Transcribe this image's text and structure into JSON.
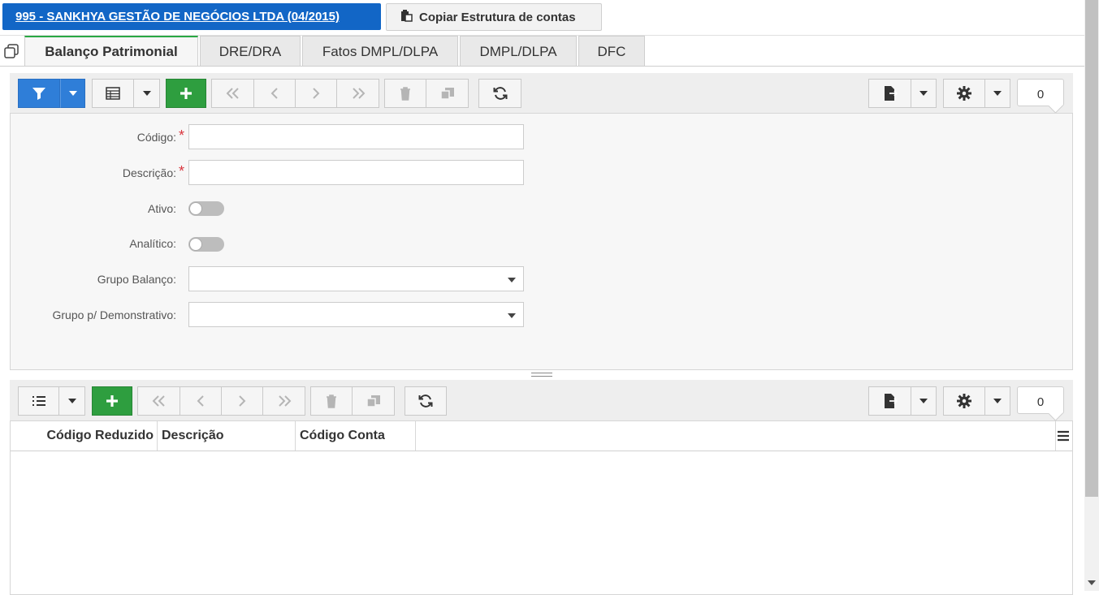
{
  "header": {
    "company_label": "995 - SANKHYA GESTÃO DE NEGÓCIOS LTDA (04/2015)",
    "copy_structure_label": "Copiar Estrutura de contas"
  },
  "tabs": [
    {
      "label": "Balanço Patrimonial",
      "active": true
    },
    {
      "label": "DRE/DRA",
      "active": false
    },
    {
      "label": "Fatos DMPL/DLPA",
      "active": false
    },
    {
      "label": "DMPL/DLPA",
      "active": false
    },
    {
      "label": "DFC",
      "active": false
    }
  ],
  "top_toolbar": {
    "record_count": "0",
    "icons": [
      "filter-icon",
      "caret-down-icon",
      "table-view-icon",
      "plus-icon",
      "first-page-icon",
      "previous-icon",
      "next-icon",
      "last-page-icon",
      "trash-icon",
      "duplicate-icon",
      "refresh-icon",
      "export-icon",
      "gear-icon"
    ]
  },
  "form": {
    "codigo_label": "Código:",
    "codigo_value": "",
    "descricao_label": "Descrição:",
    "descricao_value": "",
    "ativo_label": "Ativo:",
    "ativo_on": false,
    "analitico_label": "Analítico:",
    "analitico_on": false,
    "grupo_balanco_label": "Grupo Balanço:",
    "grupo_balanco_value": "",
    "grupo_demonstrativo_label": "Grupo p/ Demonstrativo:",
    "grupo_demonstrativo_value": "",
    "required_mark": "*"
  },
  "bottom_toolbar": {
    "record_count": "0"
  },
  "grid": {
    "columns": [
      "Código Reduzido",
      "Descrição",
      "Código Conta"
    ],
    "rows": []
  },
  "colors": {
    "primary_blue": "#1266c6",
    "filter_blue": "#2f7ed8",
    "add_green": "#2e9e3f",
    "required_red": "#d9363e",
    "active_tab_accent": "#2aa844"
  }
}
